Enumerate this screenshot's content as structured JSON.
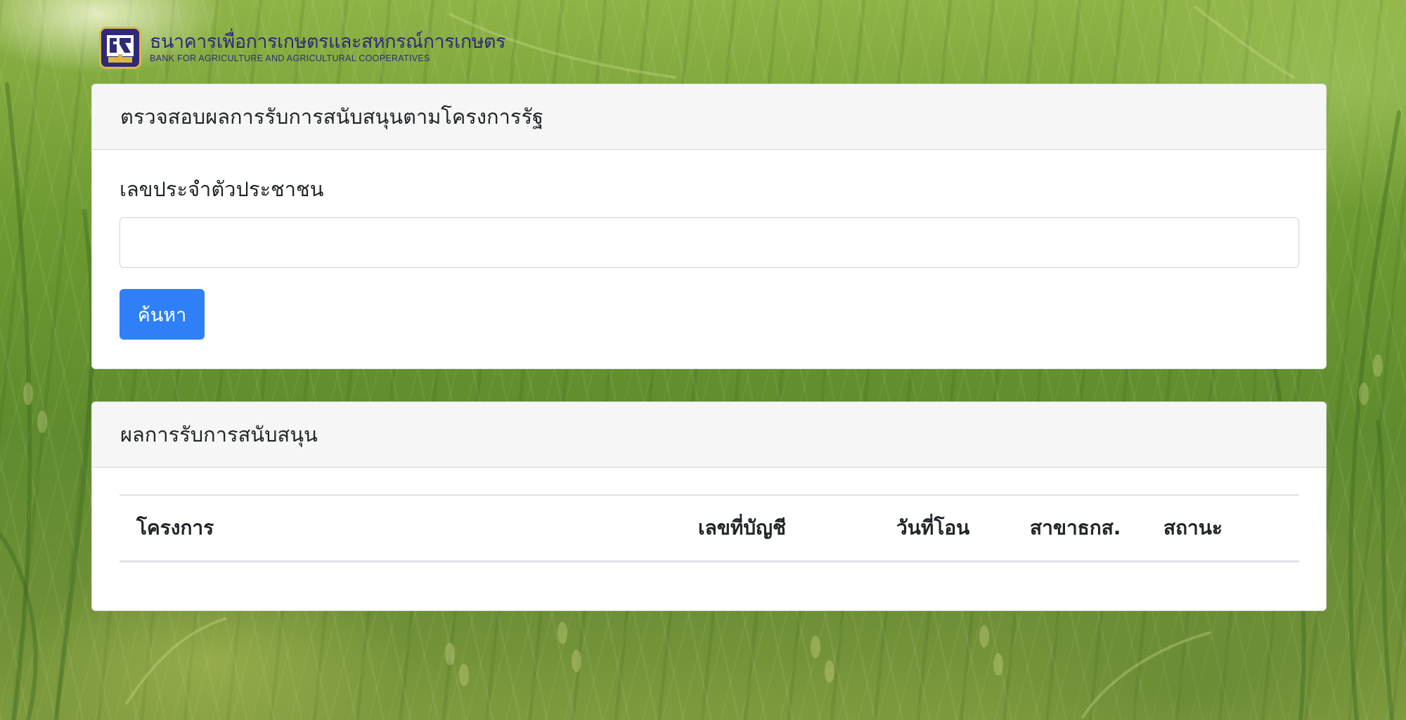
{
  "brand": {
    "name_th": "ธนาคารเพื่อการเกษตรและสหกรณ์การเกษตร",
    "name_en": "BANK FOR AGRICULTURE AND AGRICULTURAL COOPERATIVES",
    "emblem_icon": "baac-emblem-icon",
    "primary_color": "#2e2a78",
    "accent_color": "#d9b64a"
  },
  "search_card": {
    "title": "ตรวจสอบผลการรับการสนับสนุนตามโครงการรัฐ",
    "id_label": "เลขประจำตัวประชาชน",
    "id_value": "",
    "id_placeholder": "",
    "search_button": "ค้นหา",
    "button_color": "#2f80f6"
  },
  "results_card": {
    "title": "ผลการรับการสนับสนุน",
    "columns": [
      "โครงการ",
      "เลขที่บัญชี",
      "วันที่โอน",
      "สาขาธกส.",
      "สถานะ"
    ],
    "rows": []
  },
  "background": {
    "theme": "rice-field-photo"
  }
}
